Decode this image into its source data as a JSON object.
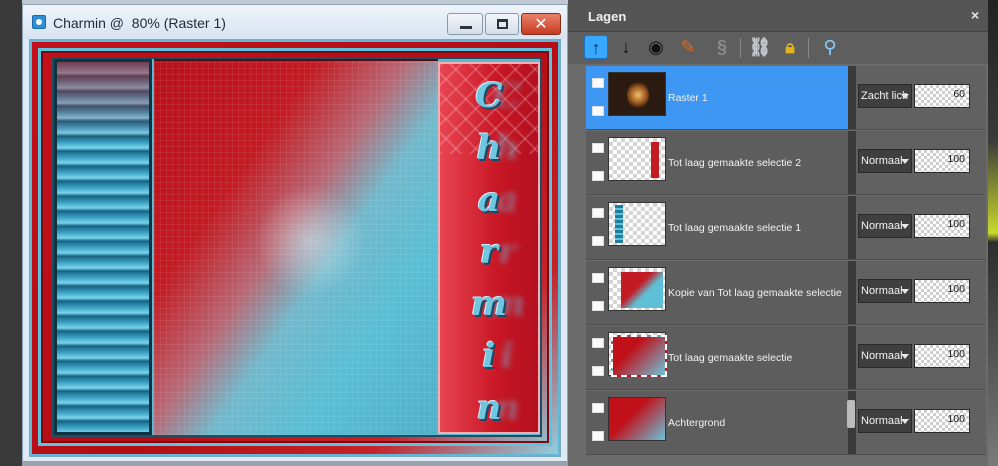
{
  "image_window": {
    "title": "Charmin @  80% (Raster 1)",
    "canvas_text": [
      "C",
      "h",
      "a",
      "r",
      "m",
      "i",
      "n"
    ]
  },
  "palette": {
    "title": "Lagen",
    "close": "×",
    "toolbar": [
      {
        "icon": "move-layer-up-icon"
      },
      {
        "icon": "move-layer-down-icon"
      },
      {
        "icon": "toggle-visibility-icon"
      },
      {
        "icon": "edit-selection-icon"
      },
      {
        "icon": "link-layers-icon"
      },
      {
        "icon": "lock-transparency-icon"
      },
      {
        "icon": "layer-properties-icon"
      }
    ],
    "layers": [
      {
        "name": "Raster 1",
        "blend": "Zacht lich",
        "opacity": "60",
        "selected": true
      },
      {
        "name": "Tot laag gemaakte selectie 2",
        "blend": "Normaal",
        "opacity": "100"
      },
      {
        "name": "Tot laag gemaakte selectie 1",
        "blend": "Normaal",
        "opacity": "100"
      },
      {
        "name": "Kopie van Tot laag gemaakte selectie",
        "blend": "Normaal",
        "opacity": "100"
      },
      {
        "name": "Tot laag gemaakte selectie",
        "blend": "Normaal",
        "opacity": "100"
      },
      {
        "name": "Achtergrond",
        "blend": "Normaal",
        "opacity": "100"
      }
    ]
  },
  "colors": {
    "selection": "#3e97f2",
    "accent_red": "#c0111b",
    "accent_cyan": "#5fbfd6"
  }
}
